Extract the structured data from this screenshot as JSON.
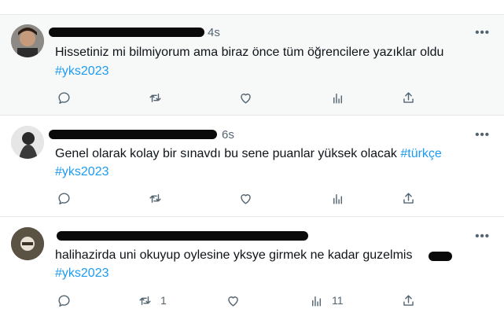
{
  "tweets": [
    {
      "time": "4s",
      "text": "Hissetiniz mi bilmiyorum ama biraz önce tüm öğrencilere yazıklar oldu",
      "line2": "#yks2023",
      "reply_count": "",
      "retweet_count": "",
      "view_count": ""
    },
    {
      "time": "6s",
      "text": "Genel olarak kolay bir sınavdı bu sene puanlar yüksek olacak ",
      "text_tag": "#türkçe",
      "line2": "#yks2023",
      "reply_count": "",
      "retweet_count": "",
      "view_count": ""
    },
    {
      "time": "",
      "text": "halihazirda uni okuyup oylesine yksye girmek ne kadar guzelmis",
      "line2": "#yks2023",
      "reply_count": "",
      "retweet_count": "1",
      "view_count": "11"
    }
  ],
  "more_label": "•••",
  "colors": {
    "accent": "#1d9bf0",
    "muted": "#536471",
    "highlight_bg": "#f7f9f9"
  },
  "icons": [
    "reply-icon",
    "retweet-icon",
    "like-icon",
    "views-icon",
    "share-icon"
  ]
}
